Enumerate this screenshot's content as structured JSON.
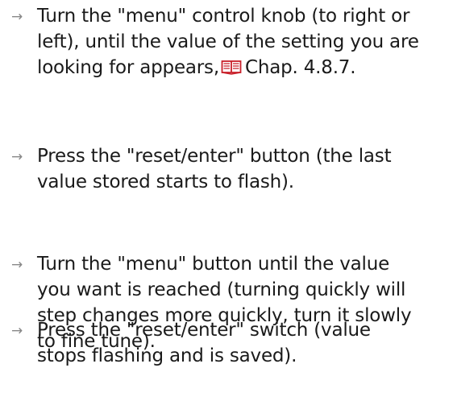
{
  "steps": [
    {
      "lines": [
        "Turn the \"menu\" control knob (to right or",
        "left), until the value of the setting you are",
        "looking for appears,"
      ],
      "reference": "Chap. 4.8.7."
    },
    {
      "lines": [
        "Press the \"reset/enter\" button (the last",
        "value stored starts to flash)."
      ]
    },
    {
      "lines": [
        "Turn the \"menu\" button until the value",
        "you want is reached (turning quickly will",
        "step changes more quickly, turn it slowly",
        "to fine tune)."
      ]
    },
    {
      "lines": [
        "Press the \"reset/enter\" switch (value",
        "stops flashing and is saved)."
      ]
    }
  ],
  "bullet_glyph": "→",
  "icons": {
    "reference": "book-icon"
  },
  "colors": {
    "text": "#1a1a1a",
    "bullet": "#888888",
    "book_icon": "#c8202a"
  }
}
